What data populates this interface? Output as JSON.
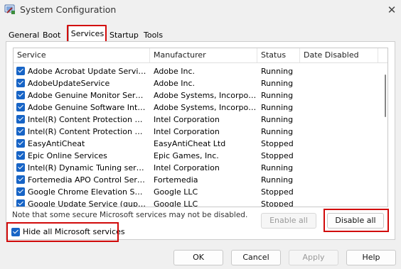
{
  "window": {
    "title": "System Configuration",
    "close_glyph": "✕"
  },
  "tabs": [
    {
      "label": "General"
    },
    {
      "label": "Boot"
    },
    {
      "label": "Services",
      "selected": true
    },
    {
      "label": "Startup"
    },
    {
      "label": "Tools"
    }
  ],
  "services": {
    "columns": [
      "Service",
      "Manufacturer",
      "Status",
      "Date Disabled"
    ],
    "rows": [
      {
        "service": "Adobe Acrobat Update Service",
        "manufacturer": "Adobe Inc.",
        "status": "Running",
        "checked": true
      },
      {
        "service": "AdobeUpdateService",
        "manufacturer": "Adobe Inc.",
        "status": "Running",
        "checked": true
      },
      {
        "service": "Adobe Genuine Monitor Service",
        "manufacturer": "Adobe Systems, Incorpora...",
        "status": "Running",
        "checked": true
      },
      {
        "service": "Adobe Genuine Software Integri...",
        "manufacturer": "Adobe Systems, Incorpora...",
        "status": "Running",
        "checked": true
      },
      {
        "service": "Intel(R) Content Protection HEC...",
        "manufacturer": "Intel Corporation",
        "status": "Running",
        "checked": true
      },
      {
        "service": "Intel(R) Content Protection HDC...",
        "manufacturer": "Intel Corporation",
        "status": "Running",
        "checked": true
      },
      {
        "service": "EasyAntiCheat",
        "manufacturer": "EasyAntiCheat Ltd",
        "status": "Stopped",
        "checked": true
      },
      {
        "service": "Epic Online Services",
        "manufacturer": "Epic Games, Inc.",
        "status": "Stopped",
        "checked": true
      },
      {
        "service": "Intel(R) Dynamic Tuning service",
        "manufacturer": "Intel Corporation",
        "status": "Running",
        "checked": true
      },
      {
        "service": "Fortemedia APO Control Service",
        "manufacturer": "Fortemedia",
        "status": "Running",
        "checked": true
      },
      {
        "service": "Google Chrome Elevation Servic...",
        "manufacturer": "Google LLC",
        "status": "Stopped",
        "checked": true
      },
      {
        "service": "Google Update Service (gupdate)",
        "manufacturer": "Google LLC",
        "status": "Stopped",
        "checked": true
      }
    ]
  },
  "note": "Note that some secure Microsoft services may not be disabled.",
  "hide_microsoft": {
    "label": "Hide all Microsoft services",
    "checked": true
  },
  "buttons": {
    "enable_all": "Enable all",
    "disable_all": "Disable all",
    "ok": "OK",
    "cancel": "Cancel",
    "apply": "Apply",
    "help": "Help"
  },
  "colors": {
    "checkbox": "#1764c6",
    "highlight": "#d10a0a"
  }
}
